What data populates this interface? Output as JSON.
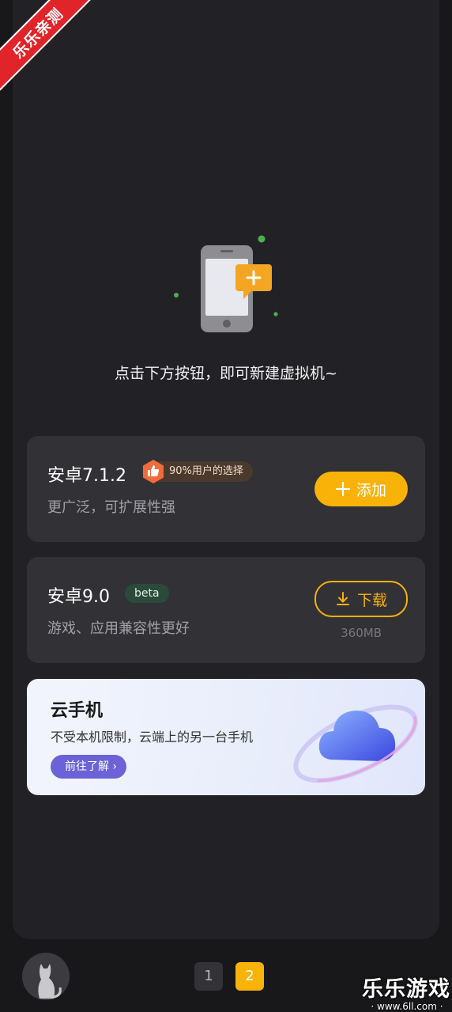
{
  "watermark": {
    "ribbon": "乐乐亲测",
    "brand": "乐乐游戏",
    "url": "· www.6ll.com ·"
  },
  "empty_state": {
    "illustration": "phone-add-icon",
    "hint": "点击下方按钮，即可新建虚拟机~"
  },
  "options": [
    {
      "title": "安卓7.1.2",
      "badge": "90%用户的选择",
      "badge_icon": "thumbs-up-icon",
      "subtitle": "更广泛，可扩展性强",
      "action_label": "添加",
      "action_icon": "plus-icon"
    },
    {
      "title": "安卓9.0",
      "badge": "beta",
      "subtitle": "游戏、应用兼容性更好",
      "action_label": "下载",
      "action_icon": "download-icon",
      "size": "360MB"
    }
  ],
  "cloud_banner": {
    "title": "云手机",
    "subtitle": "不受本机限制，云端上的另一台手机",
    "cta": "前往了解",
    "cta_icon": "chevron-right-icon",
    "graphic": "cloud-icon"
  },
  "pagination": {
    "pages": [
      "1",
      "2"
    ],
    "current": "2"
  },
  "footer": {
    "avatar": "cat-avatar-icon"
  },
  "colors": {
    "accent": "#f9b208",
    "card": "#313136",
    "background": "#222226"
  }
}
